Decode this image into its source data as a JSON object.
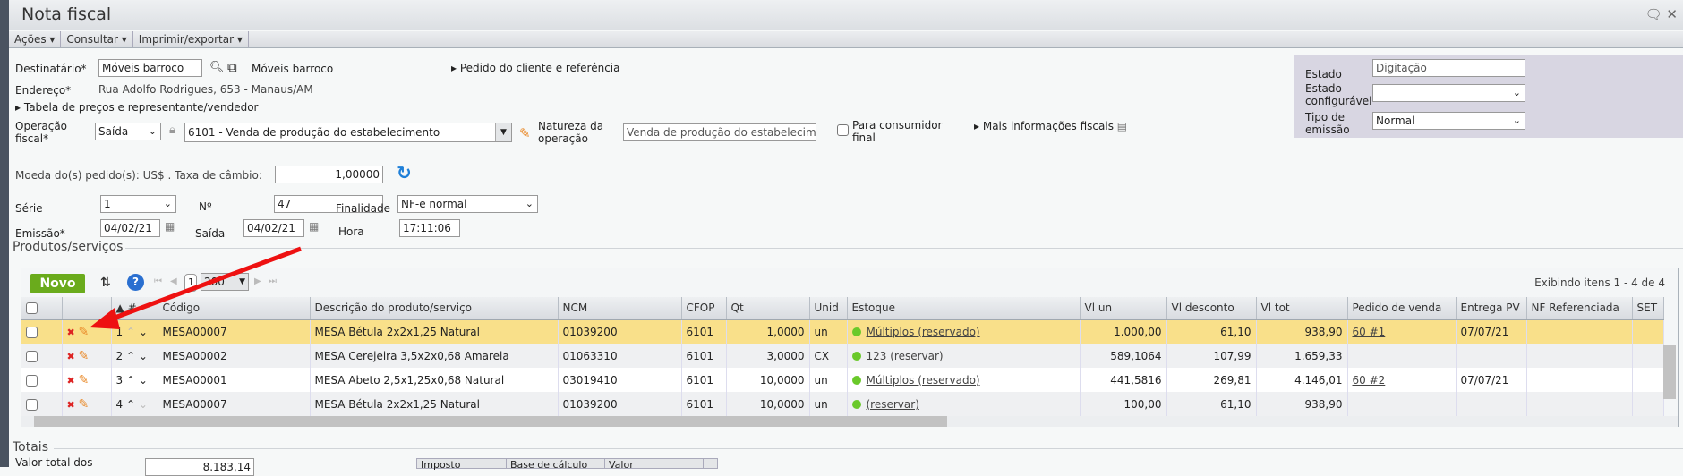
{
  "window": {
    "title": "Nota fiscal"
  },
  "menu": [
    "Ações",
    "Consultar",
    "Imprimir/exportar"
  ],
  "form": {
    "destinatario_label": "Destinatário*",
    "destinatario_value": "Móveis barroco",
    "destinatario_link": "Móveis barroco",
    "pedido_cliente": "Pedido do cliente e referência",
    "endereco_label": "Endereço*",
    "endereco_value": "Rua Adolfo Rodrigues, 653 - Manaus/AM",
    "tabela": "Tabela de preços e representante/vendedor",
    "operacao_label": "Operação fiscal*",
    "operacao_value": "Saída",
    "cfop_value": "6101 - Venda de produção do estabelecimento",
    "natureza_label": "Natureza da operação",
    "natureza_value": "Venda de produção do estabelecime",
    "consumidor_label": "Para consumidor final",
    "mais_info": "Mais informações fiscais",
    "moeda_label": "Moeda do(s) pedido(s): US$ . Taxa de câmbio:",
    "taxa_value": "1,00000",
    "serie_label": "Série",
    "serie_value": "1",
    "numero_label": "Nº",
    "numero_value": "47",
    "finalidade_label": "Finalidade",
    "finalidade_value": "NF-e normal",
    "emissao_label": "Emissão*",
    "emissao_value": "04/02/21",
    "saida_label": "Saída",
    "saida_value": "04/02/21",
    "hora_label": "Hora",
    "hora_value": "17:11:06"
  },
  "status": {
    "estado_label": "Estado",
    "estado_value": "Digitação",
    "estado_conf_label": "Estado configurável",
    "estado_conf_value": "",
    "tipo_label": "Tipo de emissão",
    "tipo_value": "Normal"
  },
  "produtos": {
    "legend": "Produtos/serviços",
    "novo": "Novo",
    "page": "1",
    "page_size": "200",
    "summary": "Exibindo itens 1 - 4 de 4",
    "columns": [
      "#",
      "Código",
      "Descrição do produto/serviço",
      "NCM",
      "CFOP",
      "Qt",
      "Unid",
      "Estoque",
      "Vl un",
      "Vl desconto",
      "Vl tot",
      "Pedido de venda",
      "Entrega PV",
      "NF Referenciada",
      "SET"
    ],
    "rows": [
      {
        "n": "1",
        "codigo": "MESA00007",
        "desc": "MESA Bétula 2x2x1,25 Natural",
        "ncm": "01039200",
        "cfop": "6101",
        "qt": "1,0000",
        "unid": "un",
        "estoque": "Múltiplos (reservado)",
        "vlun": "1.000,00",
        "vldesc": "61,10",
        "vltot": "938,90",
        "pedido": "60 #1",
        "entrega": "07/07/21"
      },
      {
        "n": "2",
        "codigo": "MESA00002",
        "desc": "MESA Cerejeira 3,5x2x0,68 Amarela",
        "ncm": "01063310",
        "cfop": "6101",
        "qt": "3,0000",
        "unid": "CX",
        "estoque": "123 (reservar)",
        "vlun": "589,1064",
        "vldesc": "107,99",
        "vltot": "1.659,33",
        "pedido": "",
        "entrega": ""
      },
      {
        "n": "3",
        "codigo": "MESA00001",
        "desc": "MESA Abeto 2,5x1,25x0,68 Natural",
        "ncm": "03019410",
        "cfop": "6101",
        "qt": "10,0000",
        "unid": "un",
        "estoque": "Múltiplos (reservado)",
        "vlun": "441,5816",
        "vldesc": "269,81",
        "vltot": "4.146,01",
        "pedido": "60 #2",
        "entrega": "07/07/21"
      },
      {
        "n": "4",
        "codigo": "MESA00007",
        "desc": "MESA Bétula 2x2x1,25 Natural",
        "ncm": "01039200",
        "cfop": "6101",
        "qt": "10,0000",
        "unid": "un",
        "estoque": "(reservar)",
        "vlun": "100,00",
        "vldesc": "61,10",
        "vltot": "938,90",
        "pedido": "",
        "entrega": ""
      }
    ]
  },
  "totais": {
    "legend": "Totais",
    "valor_label": "Valor total dos",
    "valor_value": "8.183,14",
    "tax_columns": [
      "Imposto",
      "Base de cálculo",
      "Valor"
    ]
  },
  "colors": {
    "highlight": "#f9e08a",
    "novo": "#6aab1c",
    "arrow": "#ee1111"
  }
}
